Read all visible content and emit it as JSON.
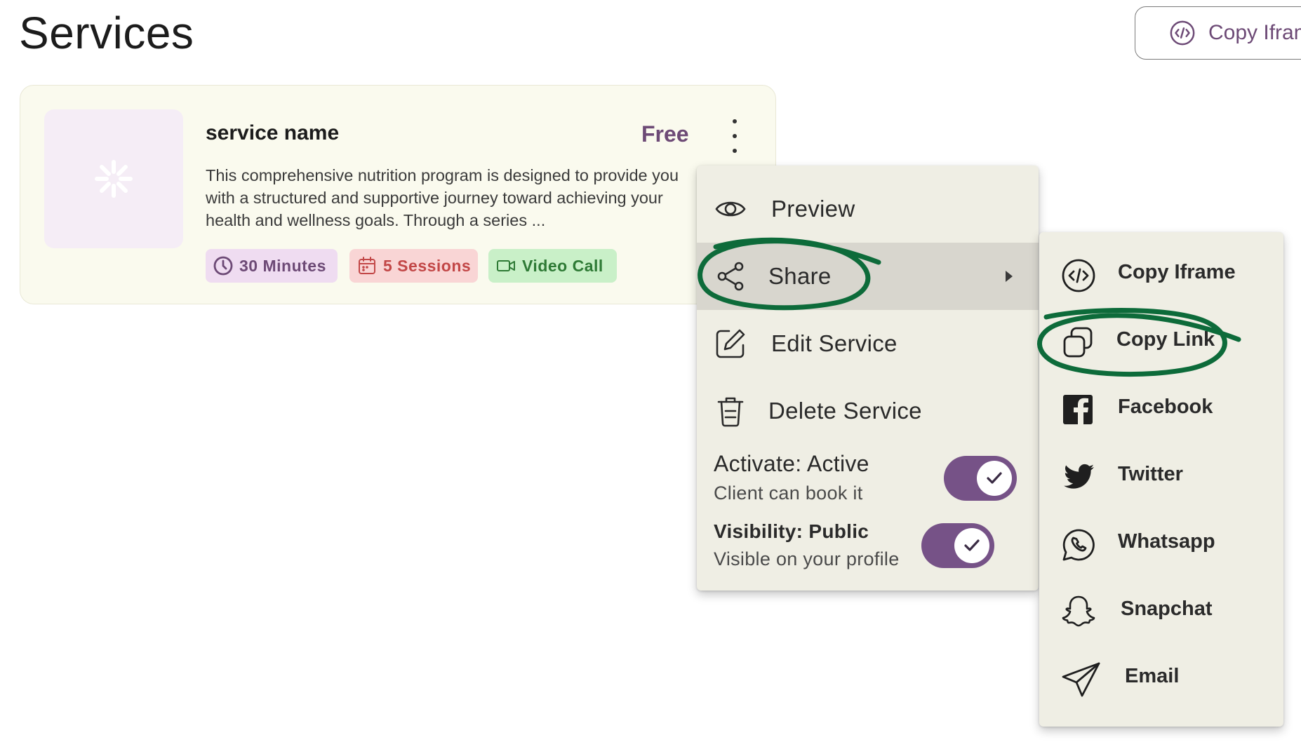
{
  "page": {
    "title": "Services"
  },
  "top_button": {
    "label": "Copy Iframe",
    "icon": "code-icon"
  },
  "service": {
    "name": "service name",
    "price": "Free",
    "description_lines": [
      "This comprehensive nutrition program is designed to provide you",
      "with a structured and supportive journey toward achieving your",
      "health and wellness goals. Through a series ..."
    ],
    "chips": [
      {
        "label": "30 Minutes",
        "icon": "clock-icon"
      },
      {
        "label": "5 Sessions",
        "icon": "calendar-icon"
      },
      {
        "label": "Video Call",
        "icon": "video-icon"
      }
    ]
  },
  "menu": {
    "items": [
      {
        "label": "Preview",
        "icon": "eye-icon"
      },
      {
        "label": "Share",
        "icon": "share-icon"
      },
      {
        "label": "Edit Service",
        "icon": "edit-icon"
      },
      {
        "label": "Delete Service",
        "icon": "trash-icon"
      }
    ],
    "activate": {
      "title": "Activate: Active",
      "subtitle": "Client can book it",
      "on": true
    },
    "visibility": {
      "title": "Visibility: Public",
      "subtitle": "Visible on your profile",
      "on": true
    }
  },
  "share_submenu": {
    "items": [
      {
        "label": "Copy Iframe",
        "icon": "code-icon"
      },
      {
        "label": "Copy Link",
        "icon": "copy-icon"
      },
      {
        "label": "Facebook",
        "icon": "facebook-icon"
      },
      {
        "label": "Twitter",
        "icon": "twitter-icon"
      },
      {
        "label": "Whatsapp",
        "icon": "whatsapp-icon"
      },
      {
        "label": "Snapchat",
        "icon": "snapchat-icon"
      },
      {
        "label": "Email",
        "icon": "send-icon"
      }
    ]
  },
  "colors": {
    "brand": "#6d4a76",
    "toggle": "#765287",
    "annotation": "#0d6b3a",
    "card_bg": "#fafaee",
    "menu_bg": "#efeee4"
  }
}
